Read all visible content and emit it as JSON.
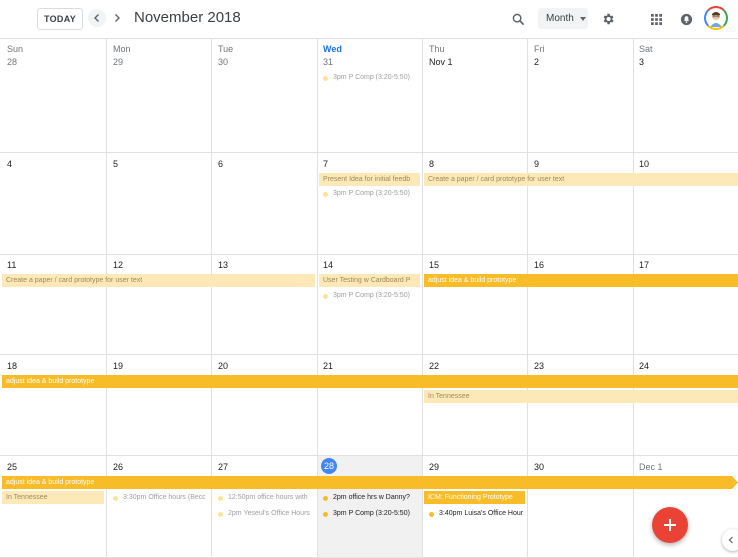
{
  "toolbar": {
    "today_label": "TODAY",
    "month_title": "November 2018",
    "view_label": "Month",
    "icons": [
      "chevron-left-icon",
      "chevron-right-icon",
      "search-icon",
      "gear-icon",
      "apps-grid-icon",
      "notifications-icon",
      "avatar"
    ]
  },
  "weekdays": [
    "Sun",
    "Mon",
    "Tue",
    "Wed",
    "Thu",
    "Fri",
    "Sat"
  ],
  "weeks": [
    [
      "28",
      "29",
      "30",
      "31",
      "Nov 1",
      "2",
      "3"
    ],
    [
      "4",
      "5",
      "6",
      "7",
      "8",
      "9",
      "10"
    ],
    [
      "11",
      "12",
      "13",
      "14",
      "15",
      "16",
      "17"
    ],
    [
      "18",
      "19",
      "20",
      "21",
      "22",
      "23",
      "24"
    ],
    [
      "25",
      "26",
      "27",
      "28",
      "29",
      "30",
      "Dec 1"
    ]
  ],
  "today": "28",
  "events": {
    "w0_wed": {
      "time": "3pm",
      "title": "P Comp (3:20-5:50)"
    },
    "w1_bar_present": "Present Idea for initial feedb",
    "w1_bar_create": "Create a paper / card prototype for user text",
    "w1_wed": {
      "time": "3pm",
      "title": "P Comp (3:20-5:50)"
    },
    "w2_bar_create": "Create a paper / card prototype for user text",
    "w2_bar_usertest": "User Testing w Cardboard P",
    "w2_bar_adjust": "adjust idea & build prototype",
    "w2_wed": {
      "time": "3pm",
      "title": "P Comp (3:20-5:50)"
    },
    "w3_bar_adjust": "adjust idea & build prototype",
    "w3_bar_tennessee": "In Tennessee",
    "w4_bar_adjust": "adjust idea & build prototype",
    "w4_bar_tennessee": "In Tennessee",
    "w4_mon": {
      "time": "3:30pm",
      "title": "Office hours (Becc"
    },
    "w4_tue1": {
      "time": "12:50pm",
      "title": "office hours with"
    },
    "w4_tue2": {
      "time": "2pm",
      "title": "Yeseul's Office Hours"
    },
    "w4_wed1": {
      "time": "2pm",
      "title": "office hrs w Danny?"
    },
    "w4_wed2": {
      "time": "3pm",
      "title": "P Comp (3:20-5:50)"
    },
    "w4_thu_bar": "ICM: Functioning Prototype",
    "w4_thu": {
      "time": "3:40pm",
      "title": "Luisa's Office Hour"
    }
  },
  "colors": {
    "today_blue": "#4285f4",
    "event_yellow": "#f7bc28",
    "event_light": "#fde9b8",
    "fab_red": "#ea4335"
  }
}
